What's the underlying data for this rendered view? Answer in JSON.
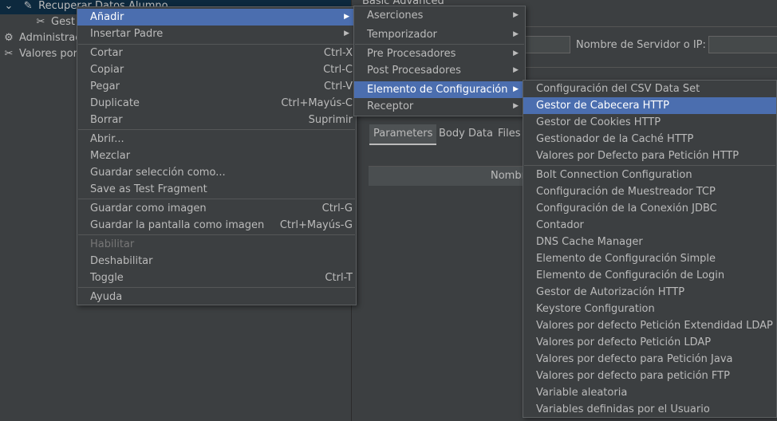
{
  "tree": {
    "items": [
      {
        "label": "Recuperar Datos Alumno",
        "icon": "pencil-icon"
      },
      {
        "label": "Gest",
        "icon": "tools-icon"
      },
      {
        "label": "Administrac",
        "icon": "gear-icon"
      },
      {
        "label": "Valores por",
        "icon": "tools-icon"
      }
    ]
  },
  "right_panel": {
    "top_tabs": "Basic  Advanced",
    "server_label": "Nombre de Servidor o IP:",
    "tabs": [
      "Parameters",
      "Body Data",
      "Files"
    ],
    "table_header": "Nombr"
  },
  "context_menu": {
    "items": [
      {
        "label": "Añadir",
        "submenu": true
      },
      {
        "label": "Insertar Padre",
        "submenu": true
      },
      {
        "label": "Cortar",
        "shortcut": "Ctrl-X"
      },
      {
        "label": "Copiar",
        "shortcut": "Ctrl-C"
      },
      {
        "label": "Pegar",
        "shortcut": "Ctrl-V"
      },
      {
        "label": "Duplicate",
        "shortcut": "Ctrl+Mayús-C"
      },
      {
        "label": "Borrar",
        "shortcut": "Suprimir"
      },
      {
        "label": "Abrir..."
      },
      {
        "label": "Mezclar"
      },
      {
        "label": "Guardar selección como..."
      },
      {
        "label": "Save as Test Fragment"
      },
      {
        "label": "Guardar como imagen",
        "shortcut": "Ctrl-G"
      },
      {
        "label": "Guardar la pantalla como imagen",
        "shortcut": "Ctrl+Mayús-G"
      },
      {
        "label": "Habilitar"
      },
      {
        "label": "Deshabilitar"
      },
      {
        "label": "Toggle",
        "shortcut": "Ctrl-T"
      },
      {
        "label": "Ayuda"
      }
    ]
  },
  "add_submenu": {
    "items": [
      {
        "label": "Aserciones"
      },
      {
        "label": "Temporizador"
      },
      {
        "label": "Pre Procesadores"
      },
      {
        "label": "Post Procesadores"
      },
      {
        "label": "Elemento de Configuración"
      },
      {
        "label": "Receptor"
      }
    ]
  },
  "config_submenu": {
    "items": [
      "Configuración del CSV Data Set",
      "Gestor de Cabecera HTTP",
      "Gestor de Cookies HTTP",
      "Gestionador de la Caché HTTP",
      "Valores por Defecto para Petición HTTP",
      "Bolt Connection Configuration",
      "Configuración de Muestreador TCP",
      "Configuración de la Conexión JDBC",
      "Contador",
      "DNS Cache Manager",
      "Elemento de Configuración Simple",
      "Elemento de Configuración de Login",
      "Gestor de Autorización HTTP",
      "Keystore Configuration",
      "Valores por defecto Petición Extendidad LDAP",
      "Valores por defecto Petición LDAP",
      "Valores por defecto para Petición Java",
      "Valores por defecto para petición FTP",
      "Variable aleatoria",
      "Variables definidas por el Usuario"
    ]
  },
  "colors": {
    "highlight": "#4b6eaf",
    "background": "#3c3f41",
    "selected_tree": "#0d293e"
  }
}
